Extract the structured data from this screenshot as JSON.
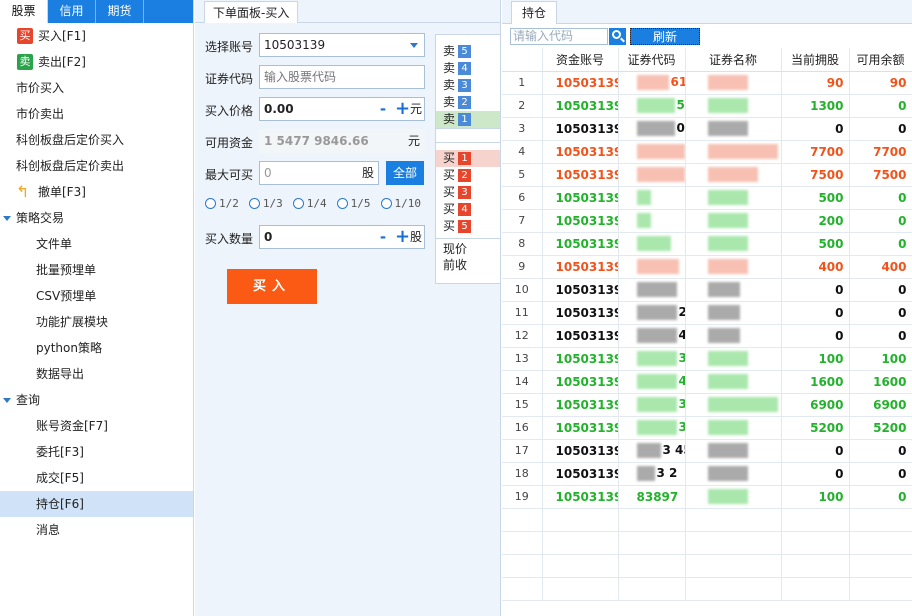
{
  "top_tabs": [
    "股票",
    "信用",
    "期货"
  ],
  "nav": {
    "buy_badge": "买",
    "buy": "买入[F1]",
    "sell_badge": "卖",
    "sell": "卖出[F2]",
    "market_buy": "市价买入",
    "market_sell": "市价卖出",
    "star_after_buy": "科创板盘后定价买入",
    "star_after_sell": "科创板盘后定价卖出",
    "cancel": "撤单[F3]",
    "strategy": "策略交易",
    "strategy_items": [
      "文件单",
      "批量预埋单",
      "CSV预埋单",
      "功能扩展模块",
      "python策略",
      "数据导出"
    ],
    "query": "查询",
    "query_items": [
      "账号资金[F7]",
      "委托[F3]",
      "成交[F5]",
      "持仓[F6]",
      "消息"
    ]
  },
  "order_panel": {
    "tab": "下单面板-买入",
    "account_label": "选择账号",
    "account_value": "10503139",
    "code_label": "证券代码",
    "code_placeholder": "输入股票代码",
    "price_label": "买入价格",
    "price_value": "0.00",
    "price_unit": "元",
    "funds_label": "可用资金",
    "funds_value": "1 5477 9846.66",
    "funds_unit": "元",
    "max_label": "最大可买",
    "max_value": "0",
    "max_unit": "股",
    "all_button": "全部",
    "fractions": [
      "1/2",
      "1/3",
      "1/4",
      "1/5",
      "1/10"
    ],
    "qty_label": "买入数量",
    "qty_value": "0",
    "qty_unit": "股",
    "buy_button": "买入",
    "minus": "-",
    "plus": "+"
  },
  "order_book": {
    "asks": [
      {
        "label": "卖",
        "n": "5"
      },
      {
        "label": "卖",
        "n": "4"
      },
      {
        "label": "卖",
        "n": "3"
      },
      {
        "label": "卖",
        "n": "2"
      },
      {
        "label": "卖",
        "n": "1"
      }
    ],
    "bids": [
      {
        "label": "买",
        "n": "1"
      },
      {
        "label": "买",
        "n": "2"
      },
      {
        "label": "买",
        "n": "3"
      },
      {
        "label": "买",
        "n": "4"
      },
      {
        "label": "买",
        "n": "5"
      }
    ],
    "current_price": "现价",
    "prev_close": "前收"
  },
  "positions": {
    "tab": "持仓",
    "search_placeholder": "请输入代码",
    "refresh": "刷新",
    "headers": [
      "",
      "资金账号",
      "证券代码",
      "证券名称",
      "当前拥股",
      "可用余额"
    ],
    "colors": {
      "red": "#f0541c",
      "green": "#22b22b",
      "black": "#111111"
    },
    "rows": [
      {
        "idx": "1",
        "acc": "10503139",
        "code": "61",
        "held": "90",
        "avail": "90",
        "color": "red"
      },
      {
        "idx": "2",
        "acc": "10503139",
        "code": "5 0",
        "held": "1300",
        "avail": "0",
        "color": "green"
      },
      {
        "idx": "3",
        "acc": "10503139",
        "code": "0",
        "held": "0",
        "avail": "0",
        "color": "black"
      },
      {
        "idx": "4",
        "acc": "10503139",
        "code": "",
        "held": "7700",
        "avail": "7700",
        "color": "red"
      },
      {
        "idx": "5",
        "acc": "10503139",
        "code": "",
        "held": "7500",
        "avail": "7500",
        "color": "red"
      },
      {
        "idx": "6",
        "acc": "10503139",
        "code": "",
        "held": "500",
        "avail": "0",
        "color": "green"
      },
      {
        "idx": "7",
        "acc": "10503139",
        "code": "",
        "held": "200",
        "avail": "0",
        "color": "green"
      },
      {
        "idx": "8",
        "acc": "10503139",
        "code": "",
        "held": "500",
        "avail": "0",
        "color": "green"
      },
      {
        "idx": "9",
        "acc": "10503139",
        "code": "",
        "held": "400",
        "avail": "400",
        "color": "red"
      },
      {
        "idx": "10",
        "acc": "10503139",
        "code": "",
        "held": "0",
        "avail": "0",
        "color": "black"
      },
      {
        "idx": "11",
        "acc": "10503139",
        "code": "2",
        "held": "0",
        "avail": "0",
        "color": "black"
      },
      {
        "idx": "12",
        "acc": "10503139",
        "code": "4",
        "held": "0",
        "avail": "0",
        "color": "black"
      },
      {
        "idx": "13",
        "acc": "10503139",
        "code": "3",
        "held": "100",
        "avail": "100",
        "color": "green"
      },
      {
        "idx": "14",
        "acc": "10503139",
        "code": "4",
        "held": "1600",
        "avail": "1600",
        "color": "green"
      },
      {
        "idx": "15",
        "acc": "10503139",
        "code": "31",
        "held": "6900",
        "avail": "6900",
        "color": "green"
      },
      {
        "idx": "16",
        "acc": "10503139",
        "code": "35",
        "held": "5200",
        "avail": "5200",
        "color": "green"
      },
      {
        "idx": "17",
        "acc": "10503139",
        "code": "3 45",
        "held": "0",
        "avail": "0",
        "color": "black"
      },
      {
        "idx": "18",
        "acc": "10503139",
        "code": "3 2",
        "held": "0",
        "avail": "0",
        "color": "black"
      },
      {
        "idx": "19",
        "acc": "10503139",
        "code": "83897",
        "held": "100",
        "avail": "0",
        "color": "green"
      }
    ]
  }
}
